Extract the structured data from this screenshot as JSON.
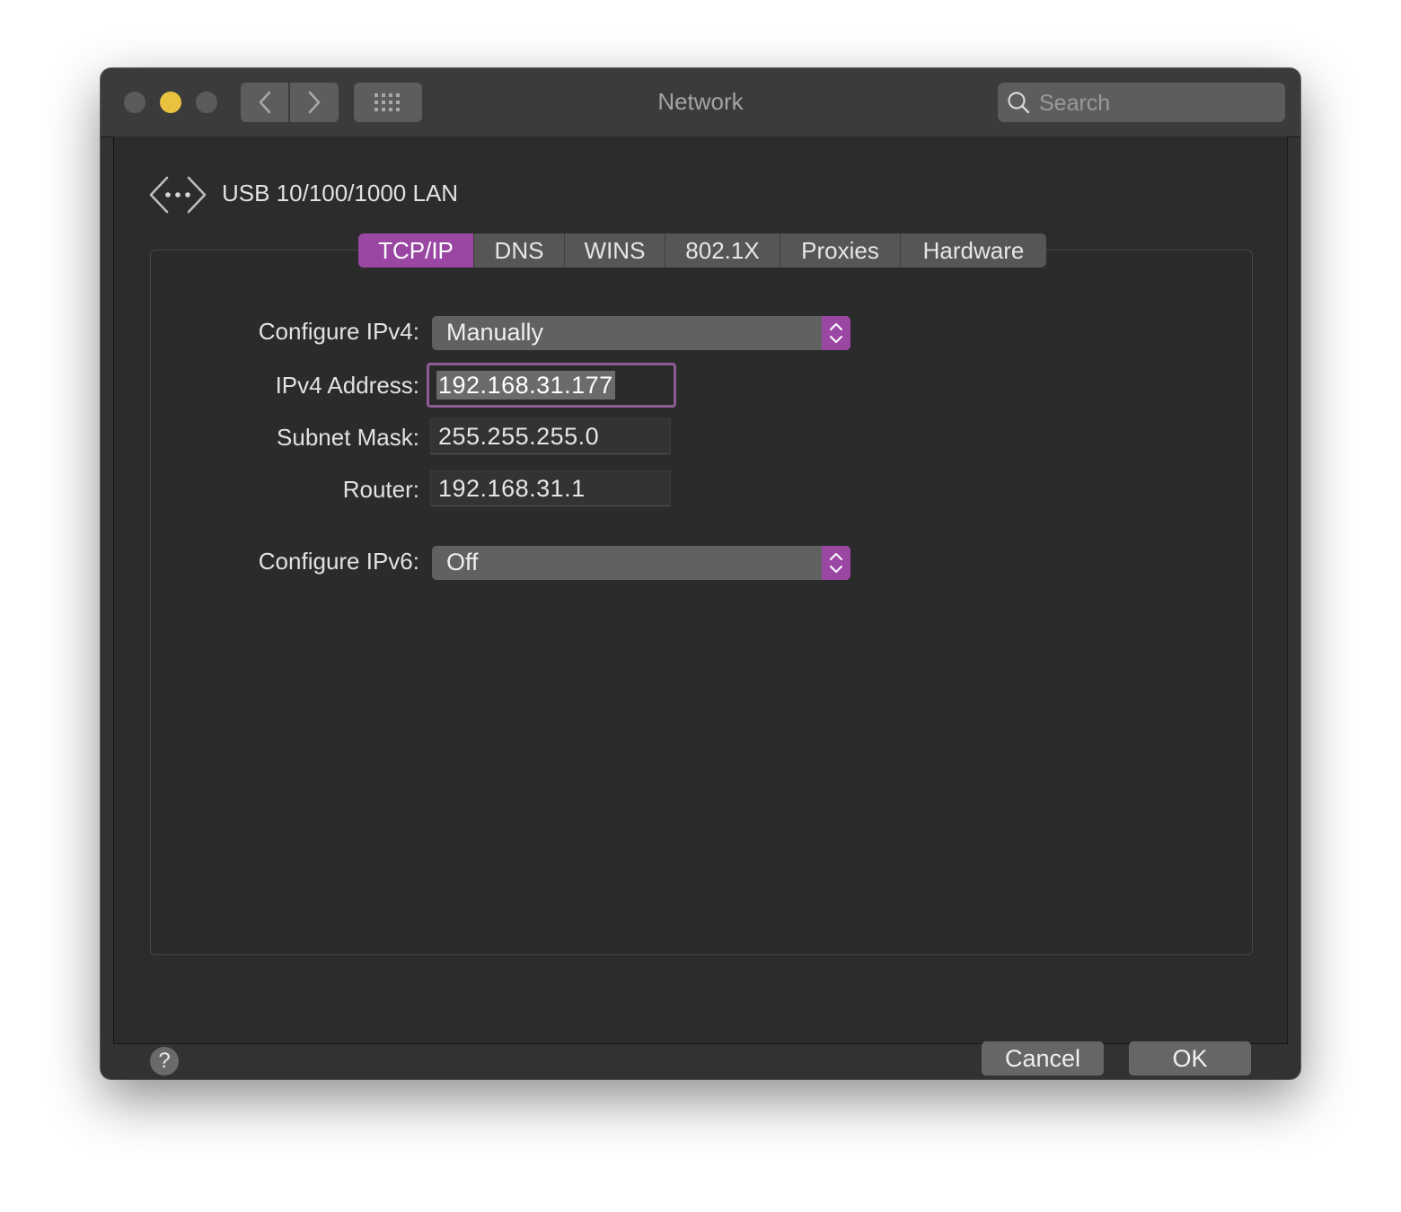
{
  "window": {
    "title": "Network",
    "search_placeholder": "Search"
  },
  "toolbar": {
    "icons": [
      "back-icon",
      "forward-icon",
      "show-all-grid-icon",
      "search-icon"
    ]
  },
  "interface": {
    "name": "USB 10/100/1000 LAN",
    "icon": "ethernet-icon"
  },
  "tabs": [
    {
      "label": "TCP/IP",
      "active": true
    },
    {
      "label": "DNS",
      "active": false
    },
    {
      "label": "WINS",
      "active": false
    },
    {
      "label": "802.1X",
      "active": false
    },
    {
      "label": "Proxies",
      "active": false
    },
    {
      "label": "Hardware",
      "active": false
    }
  ],
  "form": {
    "configure_ipv4": {
      "label": "Configure IPv4:",
      "value": "Manually"
    },
    "ipv4_address": {
      "label": "IPv4 Address:",
      "value": "192.168.31.177"
    },
    "subnet_mask": {
      "label": "Subnet Mask:",
      "value": "255.255.255.0"
    },
    "router": {
      "label": "Router:",
      "value": "192.168.31.1"
    },
    "configure_ipv6": {
      "label": "Configure IPv6:",
      "value": "Off"
    }
  },
  "footer": {
    "help": "?",
    "cancel": "Cancel",
    "ok": "OK"
  },
  "colors": {
    "accent": "#9a47a3",
    "window_bg": "#323232",
    "minimize": "#e9c340"
  }
}
